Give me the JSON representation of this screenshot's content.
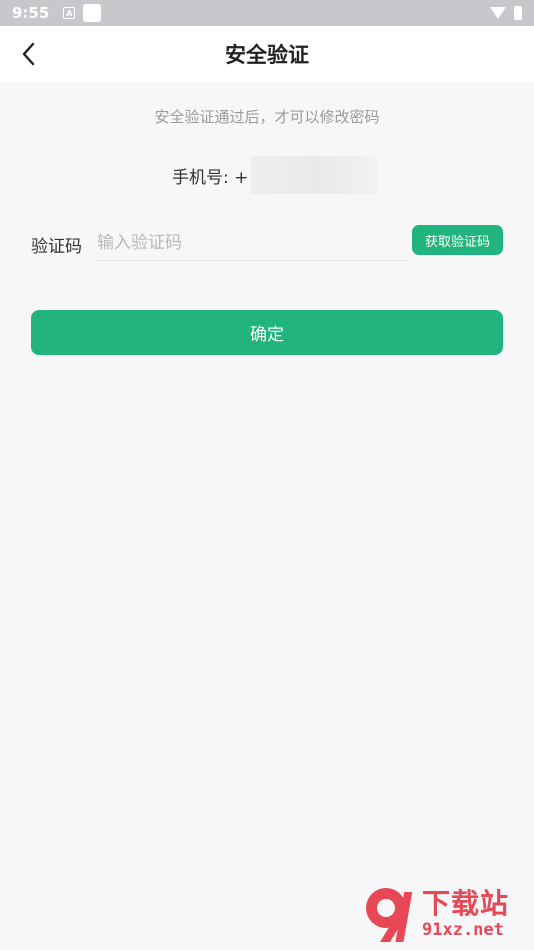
{
  "status_bar": {
    "time": "9:55",
    "notification_letter": "A"
  },
  "header": {
    "title": "安全验证",
    "back_icon": "chevron-left-icon"
  },
  "hint": "安全验证通过后，才可以修改密码",
  "phone": {
    "label": "手机号: +"
  },
  "code": {
    "label": "验证码",
    "placeholder": "输入验证码",
    "value": "",
    "get_code_label": "获取验证码"
  },
  "confirm_label": "确定",
  "watermark": {
    "title": "下载站",
    "url": "91xz.net",
    "logo_text": "9"
  },
  "colors": {
    "accent": "#22b47f",
    "background": "#f7f7fa",
    "watermark": "#e84855"
  }
}
